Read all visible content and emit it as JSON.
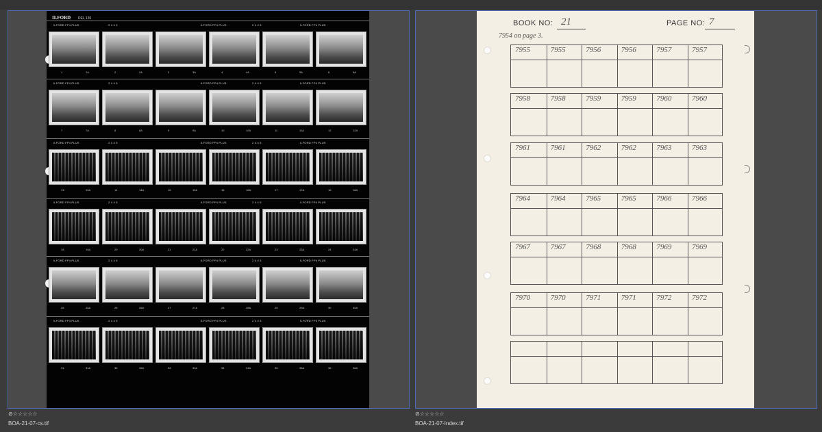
{
  "window": {
    "background": "#3b3b3b",
    "selection_border": "#4d6bb3"
  },
  "items": [
    {
      "filename": "BOA-21-07-cs.tif",
      "rating_icons": "⊘☆☆☆☆☆",
      "contact_sheet": {
        "brand": "ILFORD",
        "ref": "DEL 135",
        "film_label": "ILFORD FP4 PLUS",
        "film_code": "2 4 4 5",
        "frame_numbers": [
          [
            "1",
            "1A",
            "2",
            "2A",
            "3",
            "3A",
            "4",
            "4A",
            "5",
            "5A",
            "6",
            "6A"
          ],
          [
            "7",
            "7A",
            "8",
            "8A",
            "9",
            "9A",
            "10",
            "10A",
            "11",
            "11A",
            "12",
            "12A"
          ],
          [
            "13",
            "13A",
            "14",
            "14A",
            "15",
            "15A",
            "16",
            "16A",
            "17",
            "17A",
            "18",
            "18A"
          ],
          [
            "19",
            "19A",
            "20",
            "20A",
            "21",
            "21A",
            "22",
            "22A",
            "23",
            "23A",
            "24",
            "24A"
          ],
          [
            "25",
            "25A",
            "26",
            "26A",
            "27",
            "27A",
            "28",
            "28A",
            "29",
            "29A",
            "30",
            "30A"
          ],
          [
            "31",
            "31A",
            "32",
            "32A",
            "33",
            "33A",
            "34",
            "34A",
            "35",
            "35A",
            "36",
            "36A"
          ]
        ]
      }
    },
    {
      "filename": "BOA-21-07-Index.tif",
      "rating_icons": "⊘☆☆☆☆☆",
      "index_sheet": {
        "book_label": "BOOK NO:",
        "book_no": "21",
        "page_label": "PAGE NO:",
        "page_no": "7",
        "note": "7954 on page 3.",
        "rows": [
          [
            "7955",
            "7955",
            "7956",
            "7956",
            "7957",
            "7957"
          ],
          [
            "7958",
            "7958",
            "7959",
            "7959",
            "7960",
            "7960"
          ],
          [
            "7961",
            "7961",
            "7962",
            "7962",
            "7963",
            "7963"
          ],
          [
            "7964",
            "7964",
            "7965",
            "7965",
            "7966",
            "7966"
          ],
          [
            "7967",
            "7967",
            "7968",
            "7968",
            "7969",
            "7969"
          ],
          [
            "7970",
            "7970",
            "7971",
            "7971",
            "7972",
            "7972"
          ],
          [
            "",
            "",
            "",
            "",
            "",
            ""
          ]
        ]
      }
    }
  ]
}
